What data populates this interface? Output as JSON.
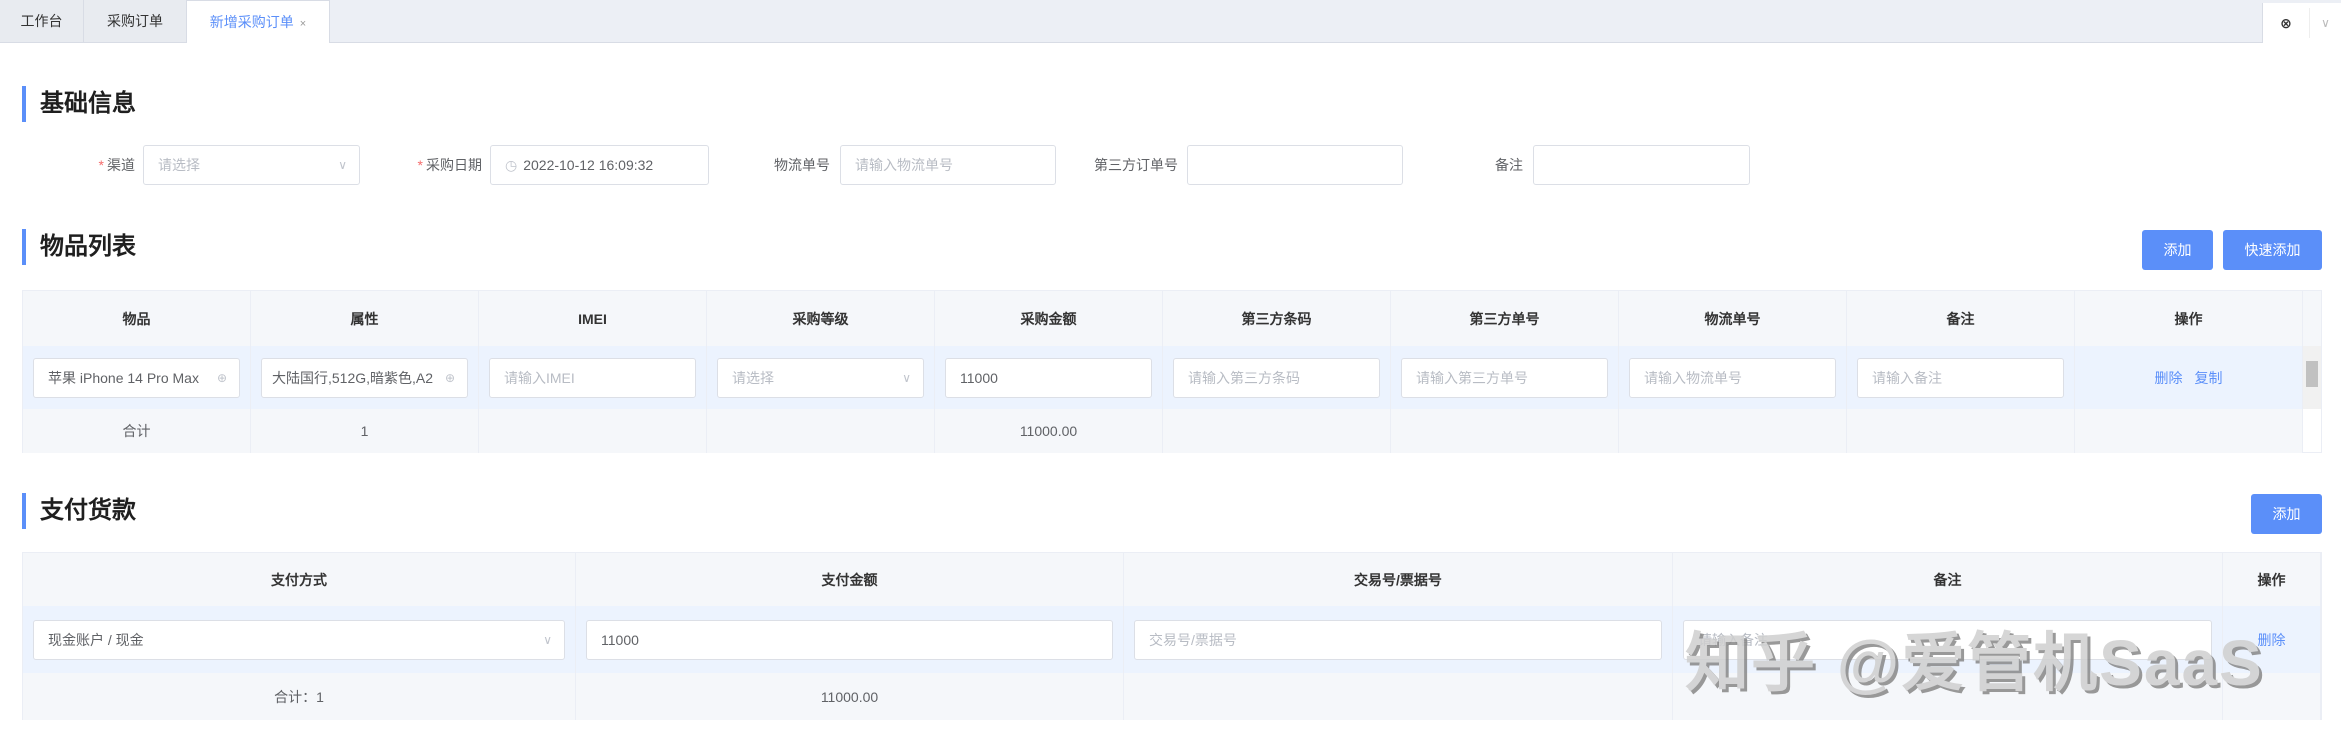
{
  "tabs": [
    {
      "label": "工作台"
    },
    {
      "label": "采购订单"
    },
    {
      "label": "新增采购订单",
      "close": "×"
    }
  ],
  "tab_controls": {
    "close_all": "⊗",
    "more": "∨"
  },
  "basic": {
    "title": "基础信息",
    "required_mark": "*",
    "channel": {
      "label": "渠道",
      "placeholder": "请选择"
    },
    "date": {
      "label": "采购日期",
      "value": "2022-10-12 16:09:32"
    },
    "logistics": {
      "label": "物流单号",
      "placeholder": "请输入物流单号"
    },
    "third_order": {
      "label": "第三方订单号",
      "value": ""
    },
    "remark": {
      "label": "备注",
      "value": ""
    }
  },
  "items": {
    "title": "物品列表",
    "add_label": "添加",
    "quick_add_label": "快速添加",
    "columns": [
      "物品",
      "属性",
      "IMEI",
      "采购等级",
      "采购金额",
      "第三方条码",
      "第三方单号",
      "物流单号",
      "备注",
      "操作"
    ],
    "row": {
      "item": "苹果 iPhone 14 Pro Max",
      "attr": "大陆国行,512G,暗紫色,A2",
      "imei_placeholder": "请输入IMEI",
      "grade_placeholder": "请选择",
      "amount": "11000",
      "barcode_placeholder": "请输入第三方条码",
      "third_no_placeholder": "请输入第三方单号",
      "logistics_placeholder": "请输入物流单号",
      "remark_placeholder": "请输入备注",
      "delete": "删除",
      "copy": "复制"
    },
    "total": {
      "label": "合计",
      "count": "1",
      "amount": "11000.00"
    }
  },
  "payment": {
    "title": "支付货款",
    "add_label": "添加",
    "columns": [
      "支付方式",
      "支付金额",
      "交易号/票据号",
      "备注",
      "操作"
    ],
    "row": {
      "method": "现金账户 / 现金",
      "amount": "11000",
      "txn_placeholder": "交易号/票据号",
      "remark_placeholder": "请输入备注",
      "delete": "删除"
    },
    "total": {
      "count": "合计：1",
      "amount": "11000.00"
    }
  },
  "watermark": "知乎 @爱管机SaaS"
}
